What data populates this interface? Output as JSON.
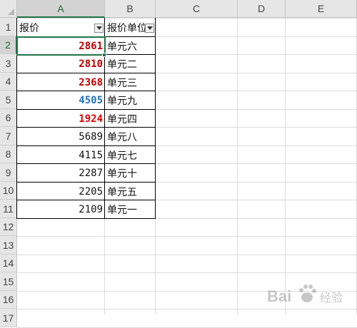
{
  "sheet": {
    "columns": [
      "A",
      "B",
      "C",
      "D",
      "E"
    ],
    "rows": [
      "1",
      "2",
      "3",
      "4",
      "5",
      "6",
      "7",
      "8",
      "9",
      "10",
      "11",
      "12",
      "13",
      "14",
      "15",
      "16",
      "17"
    ],
    "active_column": "A",
    "active_row": "2"
  },
  "table": {
    "headers": [
      "报价",
      "报价单位"
    ],
    "rows": [
      {
        "price": "2861",
        "unit": "单元六",
        "color": "#c00000",
        "bold": true
      },
      {
        "price": "2810",
        "unit": "单元二",
        "color": "#c00000",
        "bold": true
      },
      {
        "price": "2368",
        "unit": "单元三",
        "color": "#c00000",
        "bold": true
      },
      {
        "price": "4505",
        "unit": "单元九",
        "color": "#1e73be",
        "bold": true
      },
      {
        "price": "1924",
        "unit": "单元四",
        "color": "#e00000",
        "bold": true
      },
      {
        "price": "5689",
        "unit": "单元八",
        "color": "#111111",
        "bold": false
      },
      {
        "price": "4115",
        "unit": "单元七",
        "color": "#111111",
        "bold": false
      },
      {
        "price": "2287",
        "unit": "单元十",
        "color": "#111111",
        "bold": false
      },
      {
        "price": "2205",
        "unit": "单元五",
        "color": "#111111",
        "bold": false
      },
      {
        "price": "2109",
        "unit": "单元一",
        "color": "#111111",
        "bold": false
      }
    ]
  },
  "watermark": {
    "icon": "baidu-paw-icon",
    "brand": "Bai",
    "brand_suffix": "经验"
  },
  "colors": {
    "accent": "#217346",
    "red": "#c00000",
    "blue": "#1e73be"
  }
}
